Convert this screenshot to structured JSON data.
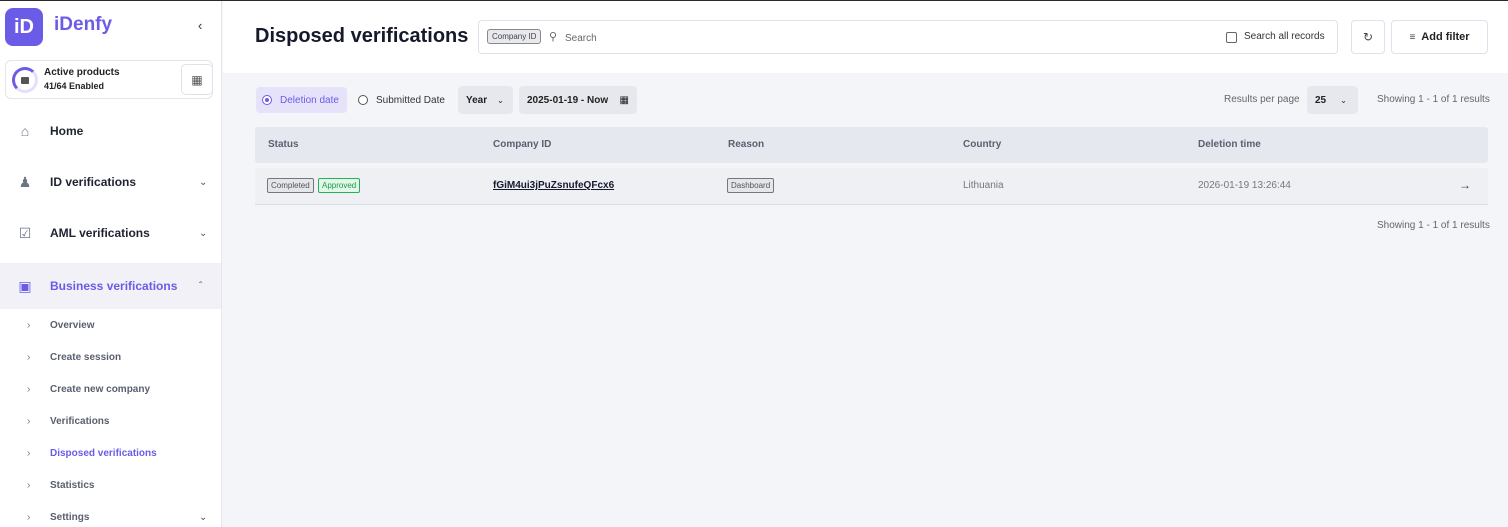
{
  "app": {
    "logo_mark": "iD",
    "logo_text": "iDenfy"
  },
  "sidebar": {
    "collapse_icon": "chevron-left-icon",
    "products": {
      "title": "Active products",
      "status": "41/64 Enabled"
    },
    "nav": [
      {
        "label": "Home",
        "icon": "home-icon"
      },
      {
        "label": "ID verifications",
        "icon": "user-check-icon"
      },
      {
        "label": "AML verifications",
        "icon": "clipboard-check-icon"
      },
      {
        "label": "Business verifications",
        "icon": "briefcase-icon"
      }
    ],
    "sub_items": [
      {
        "label": "Overview"
      },
      {
        "label": "Create session"
      },
      {
        "label": "Create new company"
      },
      {
        "label": "Verifications"
      },
      {
        "label": "Disposed verifications"
      },
      {
        "label": "Statistics"
      },
      {
        "label": "Settings"
      }
    ]
  },
  "header": {
    "title": "Disposed verifications",
    "search_tag": "Company ID",
    "search_placeholder": "Search",
    "search_all_label": "Search all records",
    "add_filter_label": "Add filter"
  },
  "filters": {
    "date_options": [
      "Deletion date",
      "Submitted Date"
    ],
    "selected_date_option": "Deletion date",
    "period": "Year",
    "date_range": "2025-01-19 - Now",
    "results_per_page_label": "Results per page",
    "results_per_page": "25",
    "showing": "Showing 1 - 1 of 1 results"
  },
  "table": {
    "columns": [
      "Status",
      "Company ID",
      "Reason",
      "Country",
      "Deletion time"
    ],
    "rows": [
      {
        "status": [
          "Completed",
          "Approved"
        ],
        "company_id": "fGiM4ui3jPuZsnufeQFcx6",
        "reason": "Dashboard",
        "country": "Lithuania",
        "deletion_time": "2026-01-19 13:26:44"
      }
    ]
  },
  "colors": {
    "accent": "#6b5ce7",
    "approved": "#1a9a4a"
  }
}
